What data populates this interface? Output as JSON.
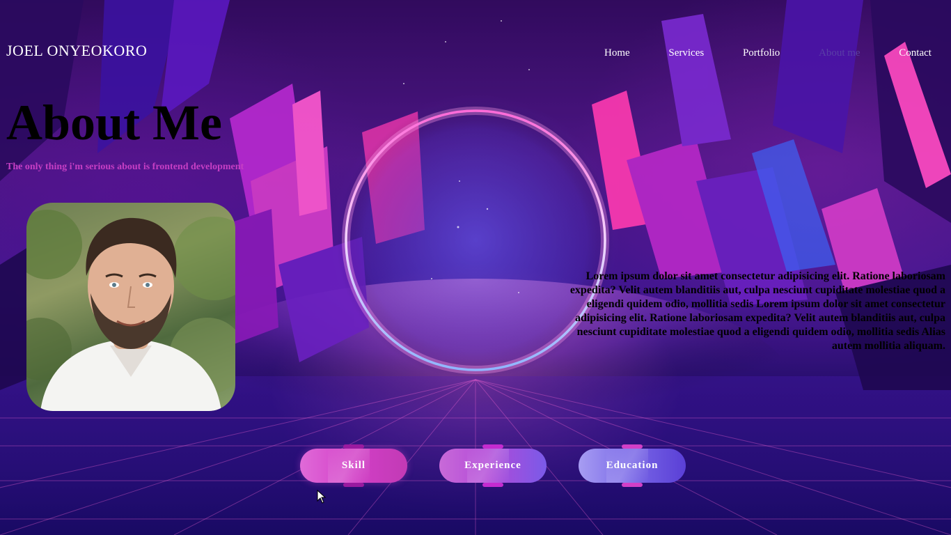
{
  "header": {
    "brand": "JOEL ONYEOKORO",
    "nav": [
      {
        "label": "Home"
      },
      {
        "label": "Services"
      },
      {
        "label": "Portfolio"
      },
      {
        "label": "About me"
      },
      {
        "label": "Contact"
      }
    ]
  },
  "hero": {
    "title": "About Me",
    "subtitle": "The only thing i'm serious about is frontend development",
    "bio": "Lorem ipsum dolor sit amet consectetur adipisicing elit. Ratione laboriosam expedita? Velit autem blanditiis aut, culpa nesciunt cupiditate molestiae quod a eligendi quidem odio, mollitia sedis Lorem ipsum dolor sit amet consectetur adipisicing elit. Ratione laboriosam expedita? Velit autem blanditiis aut, culpa nesciunt cupiditate molestiae quod a eligendi quidem odio, mollitia sedis Alias autem mollitia aliquam."
  },
  "buttons": {
    "skill": "Skill",
    "experience": "Experience",
    "education": "Education"
  },
  "colors": {
    "subtitle": "#c63fc4",
    "nav_text": "#ffffff",
    "title_text": "#000000",
    "neon_ring": "#f0b8ff"
  }
}
